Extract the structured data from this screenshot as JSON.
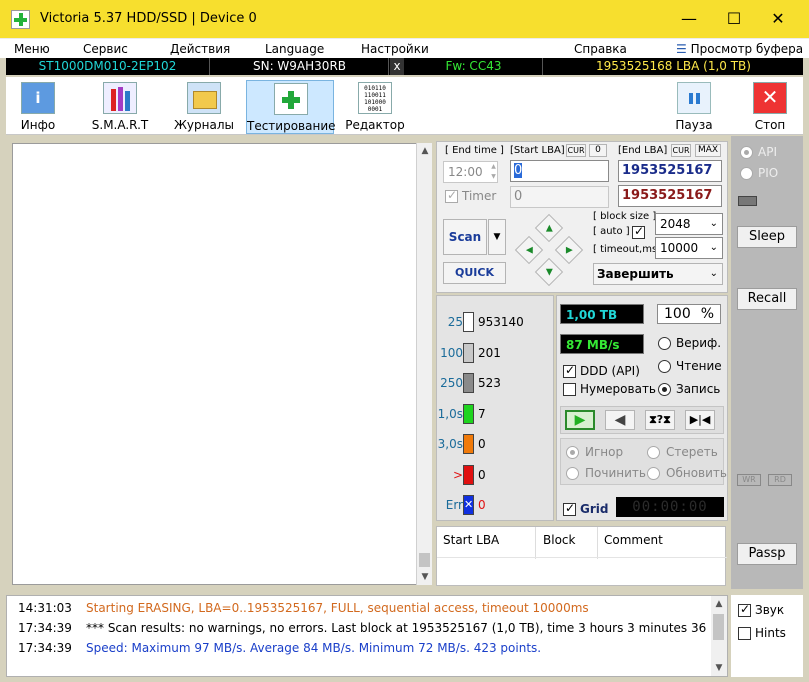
{
  "window": {
    "title": "Victoria 5.37 HDD/SSD | Device 0",
    "minimize": "—",
    "maximize": "☐",
    "close": "✕"
  },
  "menu": {
    "items": [
      "Меню",
      "Сервис",
      "Действия",
      "Language",
      "Настройки",
      "Справка"
    ],
    "buffer_view": "Просмотр буфера"
  },
  "infobar": {
    "model": "ST1000DM010-2EP102",
    "serial": "SN: W9AH30RB",
    "close": "x",
    "firmware": "Fw: CC43",
    "capacity": "1953525168 LBA (1,0 TB)",
    "colors": {
      "model": "#21d7d7",
      "serial": "#ffffff",
      "firmware": "#35e835",
      "capacity": "#ffe84a"
    }
  },
  "toolbar": {
    "info": "Инфо",
    "smart": "S.M.A.R.T",
    "logs": "Журналы",
    "testing": "Тестирование",
    "editor": "Редактор",
    "pause": "Пауза",
    "stop": "Стоп",
    "editor_icon_text": "010110\n110011\n101000\n0001"
  },
  "controls": {
    "end_time_label": "[ End time ]",
    "start_lba_label": "[Start LBA]",
    "cur1": "CUR",
    "zero": "0",
    "end_lba_label": "[End LBA]",
    "cur2": "CUR",
    "max": "MAX",
    "time_value": "12:00",
    "start_lba_value": "0",
    "end_lba_value": "1953525167",
    "timer_label": "Timer",
    "timer_value": "0",
    "end_lba_value2": "1953525167",
    "scan": "Scan",
    "quick": "QUICK",
    "block_size_label": "[ block size ]",
    "auto_label": "[ auto ]",
    "block_size_value": "2048",
    "timeout_label": "[ timeout,ms ]",
    "timeout_value": "10000",
    "finish_value": "Завершить"
  },
  "stats": [
    {
      "label": "25",
      "count": "953140",
      "color": "#ffffff",
      "label_color": "#1a6b9a"
    },
    {
      "label": "100",
      "count": "201",
      "color": "#c8c8c8",
      "label_color": "#1a6b9a"
    },
    {
      "label": "250",
      "count": "523",
      "color": "#8a8a8a",
      "label_color": "#1a6b9a"
    },
    {
      "label": "1,0s",
      "count": "7",
      "color": "#1fd41f",
      "label_color": "#1a6b9a"
    },
    {
      "label": "3,0s",
      "count": "0",
      "color": "#f07a0a",
      "label_color": "#1a6b9a"
    },
    {
      "label": ">",
      "count": "0",
      "color": "#e01010",
      "label_color": "#e01010"
    },
    {
      "label": "Err",
      "count": "0",
      "color": "#1030e0",
      "label_color": "#1a6b9a"
    }
  ],
  "progress": {
    "size": "1,00 TB",
    "percent": "100",
    "percent_sign": "%",
    "speed": "87 MB/s",
    "verify": "Вериф.",
    "read": "Чтение",
    "write": "Запись",
    "ddd": "DDD (API)",
    "numerate": "Нумеровать",
    "ignore": "Игнор",
    "erase": "Стереть",
    "repair": "Починить",
    "refresh": "Обновить",
    "grid": "Grid",
    "timer": "00:00:00"
  },
  "table": {
    "headers": [
      "Start LBA",
      "Block",
      "Comment"
    ]
  },
  "sidebar": {
    "api": "API",
    "pio": "PIO",
    "sleep": "Sleep",
    "recall": "Recall",
    "wr": "WR",
    "rd": "RD",
    "passp": "Passp"
  },
  "log": [
    {
      "time": "14:31:03",
      "text": "Starting ERASING, LBA=0..1953525167, FULL, sequential access, timeout 10000ms",
      "color": "#d2691e"
    },
    {
      "time": "17:34:39",
      "text": "*** Scan results: no warnings, no errors. Last block at 1953525167 (1,0 TB), time 3 hours 3 minutes 36 ...",
      "color": "#000000"
    },
    {
      "time": "17:34:39",
      "text": "Speed: Maximum 97 MB/s. Average 84 MB/s. Minimum 72 MB/s. 423 points.",
      "color": "#1a3fc9"
    }
  ],
  "bottom_checks": {
    "sound": "Звук",
    "hints": "Hints"
  }
}
